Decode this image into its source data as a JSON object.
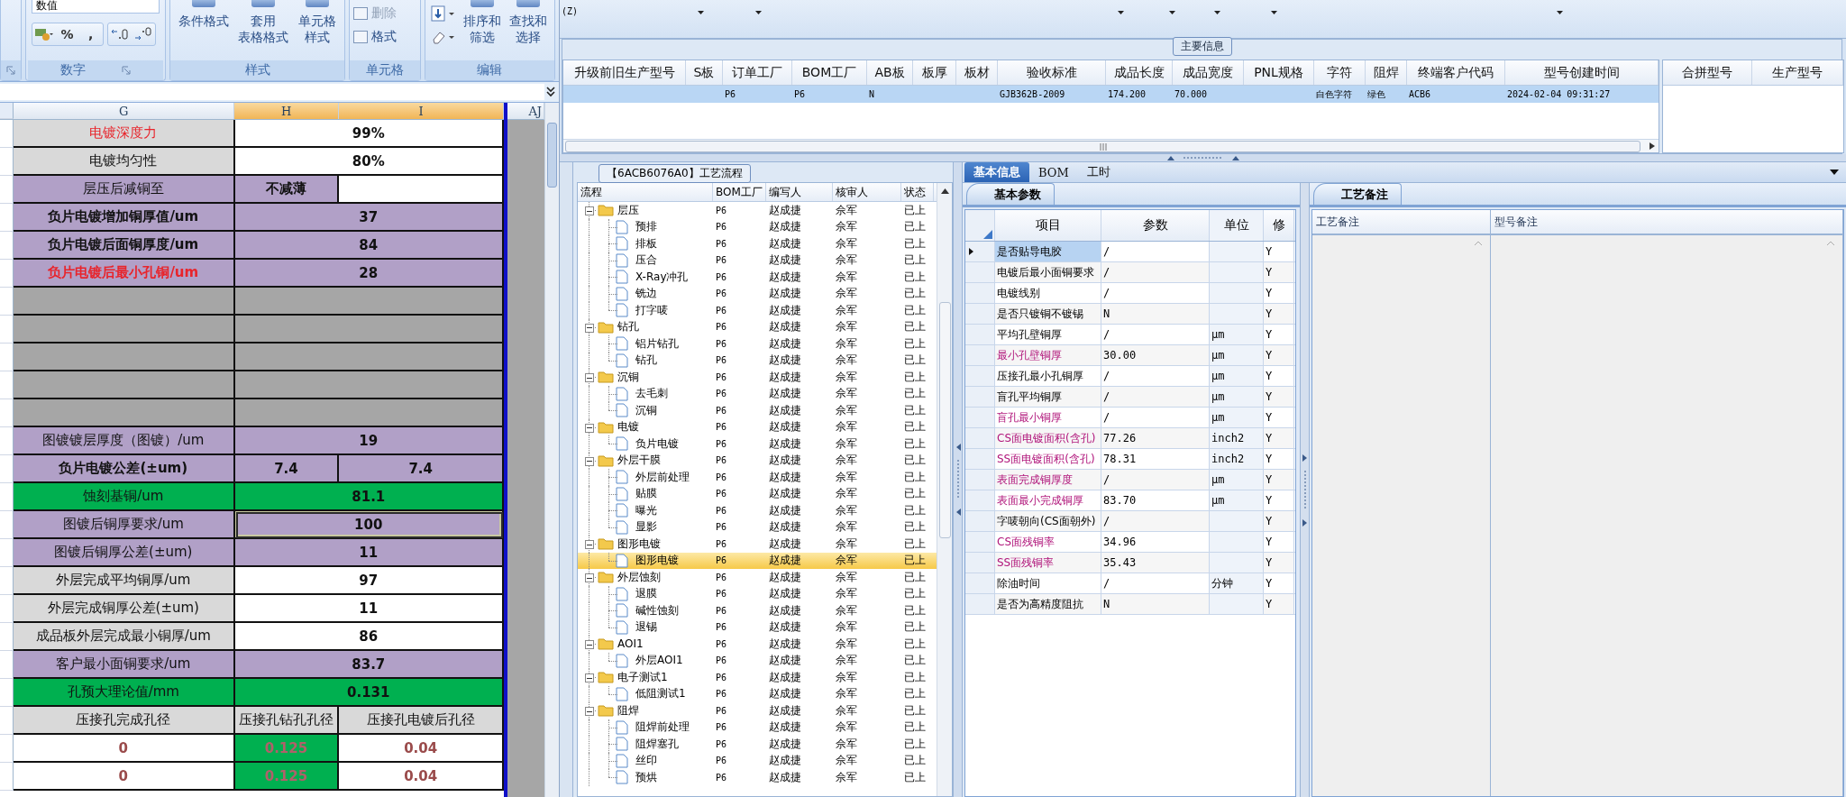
{
  "excel": {
    "number_group": {
      "format": "数值",
      "symbols": [
        "%",
        ","
      ],
      "label": "数字"
    },
    "styles_group": {
      "label": "样式",
      "buttons": [
        {
          "lines": [
            "条件格式"
          ]
        },
        {
          "lines": [
            "套用",
            "表格格式"
          ]
        },
        {
          "lines": [
            "单元格",
            "样式"
          ]
        }
      ]
    },
    "cells_group": {
      "label": "单元格",
      "buttons": [
        {
          "label": "删除",
          "disabled": true
        },
        {
          "label": "格式",
          "disabled": false
        }
      ]
    },
    "edit_group": {
      "label": "编辑",
      "buttons": [
        {
          "lines": [
            "排序和",
            "筛选"
          ]
        },
        {
          "lines": [
            "查找和",
            "选择"
          ]
        }
      ]
    },
    "columns": [
      {
        "label": "G",
        "selected": false
      },
      {
        "label": "H",
        "selected": true
      },
      {
        "label": "I",
        "selected": true
      },
      {
        "label": "AJ",
        "selected": false
      }
    ],
    "rows": [
      {
        "kind": "plain",
        "label": "电镀深度力",
        "alert": true,
        "bold": false,
        "values": [
          "99%"
        ],
        "merged": true,
        "selected": false
      },
      {
        "kind": "plain",
        "label": "电镀均匀性",
        "alert": false,
        "bold": false,
        "values": [
          "80%"
        ],
        "merged": true,
        "selected": false
      },
      {
        "kind": "purple",
        "label": "层压后减铜至",
        "alert": false,
        "bold": false,
        "values": [
          "不减薄"
        ],
        "merged": false,
        "selected": false
      },
      {
        "kind": "purple",
        "label": "负片电镀增加铜厚值/um",
        "alert": false,
        "bold": true,
        "values": [
          "37"
        ],
        "merged": true,
        "selected": false
      },
      {
        "kind": "purple",
        "label": "负片电镀后面铜厚度/um",
        "alert": false,
        "bold": true,
        "values": [
          "84"
        ],
        "merged": true,
        "selected": false
      },
      {
        "kind": "purple",
        "label": "负片电镀后最小孔铜/um",
        "alert": true,
        "bold": true,
        "values": [
          "28"
        ],
        "merged": true,
        "selected": false
      },
      {
        "kind": "empty",
        "selected": false
      },
      {
        "kind": "empty",
        "selected": false
      },
      {
        "kind": "empty",
        "selected": false
      },
      {
        "kind": "empty",
        "selected": false
      },
      {
        "kind": "empty",
        "selected": false
      },
      {
        "kind": "purple",
        "label": "图镀镀层厚度（图镀）/um",
        "alert": false,
        "bold": false,
        "values": [
          "19"
        ],
        "merged": true,
        "selected": false
      },
      {
        "kind": "purple",
        "label": "负片电镀公差(±um)",
        "alert": false,
        "bold": true,
        "values": [
          "7.4",
          "7.4"
        ],
        "selected": false
      },
      {
        "kind": "green",
        "label": "蚀刻基铜/um",
        "alert": false,
        "bold": false,
        "values": [
          "81.1"
        ],
        "merged": true,
        "selected": false
      },
      {
        "kind": "purple",
        "label": "图镀后铜厚要求/um",
        "alert": false,
        "bold": false,
        "values": [
          "100"
        ],
        "merged": true,
        "selected": true
      },
      {
        "kind": "purple",
        "label": "图镀后铜厚公差(±um)",
        "alert": false,
        "bold": false,
        "values": [
          "11"
        ],
        "merged": true,
        "selected": false
      },
      {
        "kind": "plain",
        "label": "外层完成平均铜厚/um",
        "alert": false,
        "bold": false,
        "values": [
          "97"
        ],
        "merged": true,
        "selected": false
      },
      {
        "kind": "plain",
        "label": "外层完成铜厚公差(±um)",
        "alert": false,
        "bold": false,
        "values": [
          "11"
        ],
        "merged": true,
        "selected": false
      },
      {
        "kind": "plain",
        "label": "成品板外层完成最小铜厚/um",
        "alert": false,
        "bold": false,
        "values": [
          "86"
        ],
        "merged": true,
        "selected": false
      },
      {
        "kind": "purple",
        "label": "客户最小面铜要求/um",
        "alert": false,
        "bold": false,
        "values": [
          "83.7"
        ],
        "merged": true,
        "selected": false
      },
      {
        "kind": "green",
        "label": "孔预大理论值/mm",
        "alert": false,
        "bold": false,
        "values": [
          "0.131"
        ],
        "merged": true,
        "selected": false
      },
      {
        "kind": "header",
        "label": "压接孔完成孔径",
        "alert": false,
        "bold": false,
        "values": [
          "压接孔钻孔孔径",
          "压接孔电镀后孔径"
        ],
        "selected": false
      },
      {
        "kind": "hole",
        "label": "0",
        "alert": false,
        "bold": true,
        "values": [
          "0.125",
          "0.04"
        ],
        "selected": false
      },
      {
        "kind": "hole",
        "label": "0",
        "alert": false,
        "bold": true,
        "values": [
          "0.125",
          "0.04"
        ],
        "selected": false
      }
    ]
  },
  "filter_bar": {
    "label": "(Z)"
  },
  "main_info": {
    "title": "主要信息",
    "row_selected": true,
    "columns": [
      {
        "label": "升级前旧生产型号"
      },
      {
        "label": "S板"
      },
      {
        "label": "订单工厂",
        "value": "P6"
      },
      {
        "label": "BOM工厂",
        "value": "P6"
      },
      {
        "label": "AB板",
        "value": "N"
      },
      {
        "label": "板厚"
      },
      {
        "label": "板材"
      },
      {
        "label": "验收标准",
        "value": "GJB362B-2009"
      },
      {
        "label": "成品长度",
        "value": "174.200"
      },
      {
        "label": "成品宽度",
        "value": "70.000"
      },
      {
        "label": "PNL规格"
      },
      {
        "label": "字符",
        "value": "白色字符"
      },
      {
        "label": "阻焊",
        "value": "绿色"
      },
      {
        "label": "终端客户代码",
        "value": "ACB6"
      },
      {
        "label": "型号创建时间",
        "value": "2024-02-04 09:31:27"
      }
    ],
    "side_columns": [
      "合拼型号",
      "生产型号"
    ]
  },
  "process": {
    "title": "【6ACB6076A0】工艺流程",
    "columns": [
      "流程",
      "BOM工厂",
      "编写人",
      "核审人",
      "状态"
    ],
    "tree": [
      {
        "name": "层压",
        "kind": "folder",
        "expanded": true,
        "selected": false,
        "bom": "P6",
        "author": "赵成捷",
        "reviewer": "佘军",
        "status": "已上",
        "children": [
          {
            "name": "预排",
            "kind": "step",
            "selected": false,
            "bom": "P6",
            "author": "赵成捷",
            "reviewer": "佘军",
            "status": "已上"
          },
          {
            "name": "排板",
            "kind": "step",
            "selected": false,
            "bom": "P6",
            "author": "赵成捷",
            "reviewer": "佘军",
            "status": "已上"
          },
          {
            "name": "压合",
            "kind": "step",
            "selected": false,
            "bom": "P6",
            "author": "赵成捷",
            "reviewer": "佘军",
            "status": "已上"
          },
          {
            "name": "X-Ray冲孔",
            "kind": "step",
            "selected": false,
            "bom": "P6",
            "author": "赵成捷",
            "reviewer": "佘军",
            "status": "已上"
          },
          {
            "name": "铣边",
            "kind": "step",
            "selected": false,
            "bom": "P6",
            "author": "赵成捷",
            "reviewer": "佘军",
            "status": "已上"
          },
          {
            "name": "打字唛",
            "kind": "step",
            "selected": false,
            "bom": "P6",
            "author": "赵成捷",
            "reviewer": "佘军",
            "status": "已上"
          }
        ]
      },
      {
        "name": "钻孔",
        "kind": "folder",
        "expanded": true,
        "selected": false,
        "bom": "P6",
        "author": "赵成捷",
        "reviewer": "佘军",
        "status": "已上",
        "children": [
          {
            "name": "铝片钻孔",
            "kind": "step",
            "selected": false,
            "bom": "P6",
            "author": "赵成捷",
            "reviewer": "佘军",
            "status": "已上"
          },
          {
            "name": "钻孔",
            "kind": "step",
            "selected": false,
            "bom": "P6",
            "author": "赵成捷",
            "reviewer": "佘军",
            "status": "已上"
          }
        ]
      },
      {
        "name": "沉铜",
        "kind": "folder",
        "expanded": true,
        "selected": false,
        "bom": "P6",
        "author": "赵成捷",
        "reviewer": "佘军",
        "status": "已上",
        "children": [
          {
            "name": "去毛刺",
            "kind": "step",
            "selected": false,
            "bom": "P6",
            "author": "赵成捷",
            "reviewer": "佘军",
            "status": "已上"
          },
          {
            "name": "沉铜",
            "kind": "step",
            "selected": false,
            "bom": "P6",
            "author": "赵成捷",
            "reviewer": "佘军",
            "status": "已上"
          }
        ]
      },
      {
        "name": "电镀",
        "kind": "folder",
        "expanded": true,
        "selected": false,
        "bom": "P6",
        "author": "赵成捷",
        "reviewer": "佘军",
        "status": "已上",
        "children": [
          {
            "name": "负片电镀",
            "kind": "step",
            "selected": false,
            "bom": "P6",
            "author": "赵成捷",
            "reviewer": "佘军",
            "status": "已上"
          }
        ]
      },
      {
        "name": "外层干膜",
        "kind": "folder",
        "expanded": true,
        "selected": false,
        "bom": "P6",
        "author": "赵成捷",
        "reviewer": "佘军",
        "status": "已上",
        "children": [
          {
            "name": "外层前处理",
            "kind": "step",
            "selected": false,
            "bom": "P6",
            "author": "赵成捷",
            "reviewer": "佘军",
            "status": "已上"
          },
          {
            "name": "贴膜",
            "kind": "step",
            "selected": false,
            "bom": "P6",
            "author": "赵成捷",
            "reviewer": "佘军",
            "status": "已上"
          },
          {
            "name": "曝光",
            "kind": "step",
            "selected": false,
            "bom": "P6",
            "author": "赵成捷",
            "reviewer": "佘军",
            "status": "已上"
          },
          {
            "name": "显影",
            "kind": "step",
            "selected": false,
            "bom": "P6",
            "author": "赵成捷",
            "reviewer": "佘军",
            "status": "已上"
          }
        ]
      },
      {
        "name": "图形电镀",
        "kind": "folder",
        "expanded": true,
        "selected": false,
        "bom": "P6",
        "author": "赵成捷",
        "reviewer": "佘军",
        "status": "已上",
        "children": [
          {
            "name": "图形电镀",
            "kind": "step",
            "selected": true,
            "bom": "P6",
            "author": "赵成捷",
            "reviewer": "佘军",
            "status": "已上"
          }
        ]
      },
      {
        "name": "外层蚀刻",
        "kind": "folder",
        "expanded": true,
        "selected": false,
        "bom": "P6",
        "author": "赵成捷",
        "reviewer": "佘军",
        "status": "已上",
        "children": [
          {
            "name": "退膜",
            "kind": "step",
            "selected": false,
            "bom": "P6",
            "author": "赵成捷",
            "reviewer": "佘军",
            "status": "已上"
          },
          {
            "name": "碱性蚀刻",
            "kind": "step",
            "selected": false,
            "bom": "P6",
            "author": "赵成捷",
            "reviewer": "佘军",
            "status": "已上"
          },
          {
            "name": "退锡",
            "kind": "step",
            "selected": false,
            "bom": "P6",
            "author": "赵成捷",
            "reviewer": "佘军",
            "status": "已上"
          }
        ]
      },
      {
        "name": "AOI1",
        "kind": "folder",
        "expanded": true,
        "selected": false,
        "bom": "P6",
        "author": "赵成捷",
        "reviewer": "佘军",
        "status": "已上",
        "children": [
          {
            "name": "外层AOI1",
            "kind": "step",
            "selected": false,
            "bom": "P6",
            "author": "赵成捷",
            "reviewer": "佘军",
            "status": "已上"
          }
        ]
      },
      {
        "name": "电子测试1",
        "kind": "folder",
        "expanded": true,
        "selected": false,
        "bom": "P6",
        "author": "赵成捷",
        "reviewer": "佘军",
        "status": "已上",
        "children": [
          {
            "name": "低阻测试1",
            "kind": "step",
            "selected": false,
            "bom": "P6",
            "author": "赵成捷",
            "reviewer": "佘军",
            "status": "已上"
          }
        ]
      },
      {
        "name": "阻焊",
        "kind": "folder",
        "expanded": true,
        "selected": false,
        "bom": "P6",
        "author": "赵成捷",
        "reviewer": "佘军",
        "status": "已上",
        "children": [
          {
            "name": "阻焊前处理",
            "kind": "step",
            "selected": false,
            "bom": "P6",
            "author": "赵成捷",
            "reviewer": "佘军",
            "status": "已上"
          },
          {
            "name": "阻焊塞孔",
            "kind": "step",
            "selected": false,
            "bom": "P6",
            "author": "赵成捷",
            "reviewer": "佘军",
            "status": "已上"
          },
          {
            "name": "丝印",
            "kind": "step",
            "selected": false,
            "bom": "P6",
            "author": "赵成捷",
            "reviewer": "佘军",
            "status": "已上"
          },
          {
            "name": "预烘",
            "kind": "step",
            "selected": false,
            "bom": "P6",
            "author": "赵成捷",
            "reviewer": "佘军",
            "status": "已上"
          }
        ]
      }
    ]
  },
  "details": {
    "tabs": [
      {
        "label": "基本信息",
        "selected": true
      },
      {
        "label": "BOM",
        "selected": false
      },
      {
        "label": "工时",
        "selected": false
      }
    ],
    "params": {
      "tab": "基本参数",
      "columns": [
        "项目",
        "参数",
        "单位",
        "修"
      ],
      "rows": [
        {
          "item": "是否贴导电胶",
          "value": "/",
          "modify": "Y",
          "highlight": false,
          "selected": true
        },
        {
          "item": "电镀后最小面铜要求",
          "value": "/",
          "modify": "Y",
          "highlight": false,
          "selected": false
        },
        {
          "item": "电镀线别",
          "value": "/",
          "modify": "Y",
          "highlight": false,
          "selected": false
        },
        {
          "item": "是否只镀铜不镀锡",
          "value": "N",
          "modify": "Y",
          "highlight": false,
          "selected": false
        },
        {
          "item": "平均孔壁铜厚",
          "value": "/",
          "unit": "μm",
          "modify": "Y",
          "highlight": false,
          "selected": false
        },
        {
          "item": "最小孔壁铜厚",
          "value": "30.00",
          "unit": "μm",
          "modify": "Y",
          "highlight": true,
          "selected": false
        },
        {
          "item": "压接孔最小孔铜厚",
          "value": "/",
          "unit": "μm",
          "modify": "Y",
          "highlight": false,
          "selected": false
        },
        {
          "item": "盲孔平均铜厚",
          "value": "/",
          "unit": "μm",
          "modify": "Y",
          "highlight": false,
          "selected": false
        },
        {
          "item": "盲孔最小铜厚",
          "value": "/",
          "unit": "μm",
          "modify": "Y",
          "highlight": true,
          "selected": false
        },
        {
          "item": "CS面电镀面积(含孔)",
          "value": "77.26",
          "unit": "inch2",
          "modify": "Y",
          "highlight": true,
          "selected": false
        },
        {
          "item": "SS面电镀面积(含孔)",
          "value": "78.31",
          "unit": "inch2",
          "modify": "Y",
          "highlight": true,
          "selected": false
        },
        {
          "item": "表面完成铜厚度",
          "value": "/",
          "unit": "μm",
          "modify": "Y",
          "highlight": true,
          "selected": false
        },
        {
          "item": "表面最小完成铜厚",
          "value": "83.70",
          "unit": "μm",
          "modify": "Y",
          "highlight": true,
          "selected": false
        },
        {
          "item": "字唛朝向(CS面朝外)",
          "value": "/",
          "modify": "Y",
          "highlight": false,
          "selected": false
        },
        {
          "item": "CS面残铜率",
          "value": "34.96",
          "modify": "Y",
          "highlight": true,
          "selected": false
        },
        {
          "item": "SS面残铜率",
          "value": "35.43",
          "modify": "Y",
          "highlight": true,
          "selected": false
        },
        {
          "item": "除油时间",
          "value": "/",
          "unit": "分钟",
          "modify": "Y",
          "highlight": false,
          "selected": false
        },
        {
          "item": "是否为高精度阻抗",
          "value": "N",
          "modify": "Y",
          "highlight": false,
          "selected": false
        }
      ]
    },
    "notes": {
      "tab": "工艺备注",
      "columns": [
        "工艺备注",
        "型号备注"
      ]
    }
  }
}
